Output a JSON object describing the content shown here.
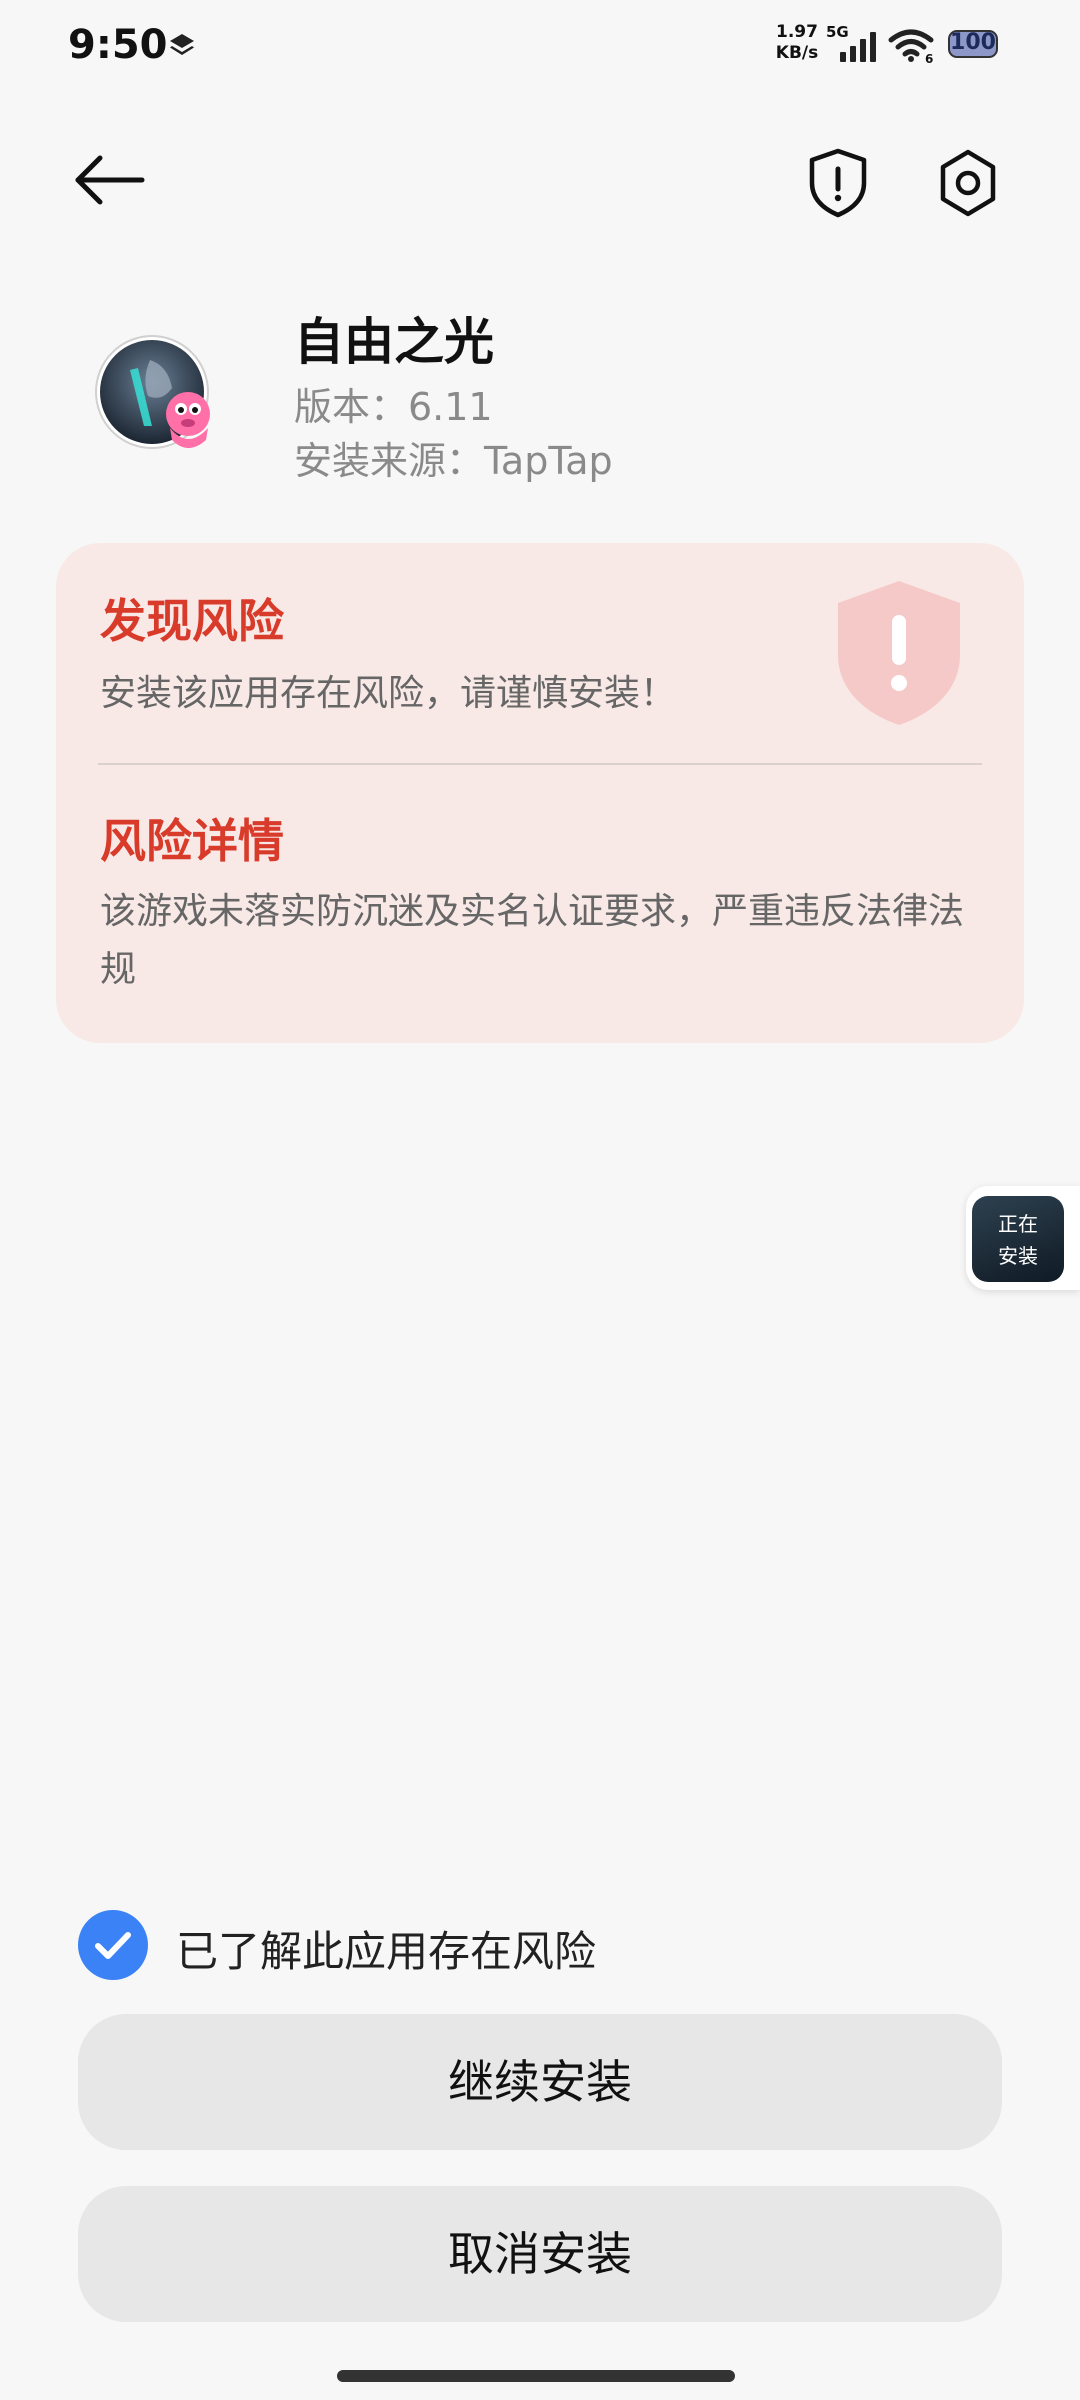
{
  "status_bar": {
    "time": "9:50",
    "net_speed_value": "1.97",
    "net_speed_unit": "KB/s",
    "network_type": "5G",
    "wifi_label": "6",
    "battery": "100"
  },
  "app": {
    "name": "自由之光",
    "version": "版本：6.11",
    "source": "安装来源：TapTap"
  },
  "risk": {
    "found_title": "发现风险",
    "found_text": "安装该应用存在风险，请谨慎安装！",
    "detail_title": "风险详情",
    "detail_text": "该游戏未落实防沉迷及实名认证要求，严重违反法律法规"
  },
  "installing_chip": {
    "line1": "正在",
    "line2": "安装"
  },
  "acknowledge": {
    "checked": true,
    "label": "已了解此应用存在风险"
  },
  "buttons": {
    "continue": "继续安装",
    "cancel": "取消安装"
  },
  "colors": {
    "risk_red": "#d93b2b",
    "risk_card_bg": "#f8e9e7",
    "checkbox_blue": "#3b82f6",
    "button_bg": "#e7e7e7",
    "page_bg": "#f7f7f7"
  }
}
